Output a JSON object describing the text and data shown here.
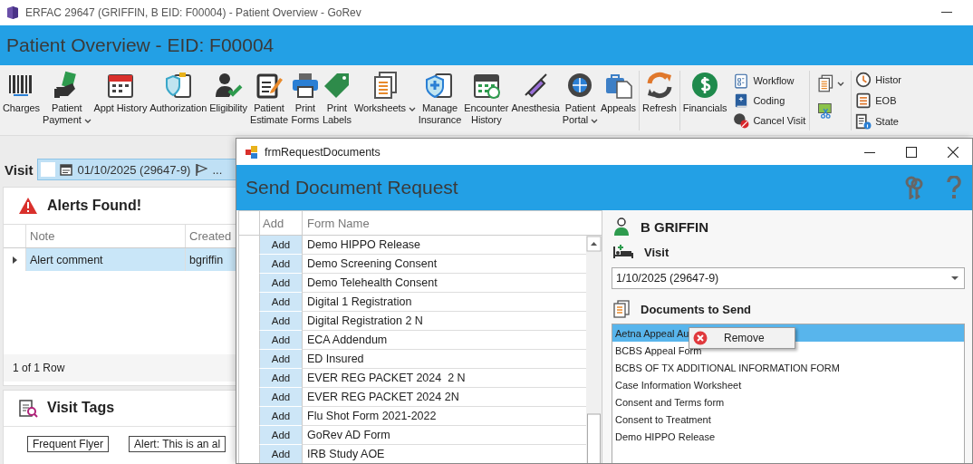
{
  "window": {
    "title": "ERFAC 29647 (GRIFFIN, B EID: F00004) - Patient Overview - GoRev"
  },
  "header": {
    "title": "Patient Overview - EID: F00004"
  },
  "toolbar": {
    "groups": [
      {
        "items": [
          {
            "kind": "large",
            "label": "Charges",
            "dropdown": false
          },
          {
            "kind": "large",
            "label": "Patient\nPayment",
            "dropdown": true
          },
          {
            "kind": "large",
            "label": "Appt History",
            "dropdown": false
          },
          {
            "kind": "large",
            "label": "Authorization",
            "dropdown": false
          },
          {
            "kind": "large",
            "label": "Eligibility",
            "dropdown": false
          },
          {
            "kind": "large",
            "label": "Patient\nEstimate",
            "dropdown": false
          },
          {
            "kind": "large",
            "label": "Print\nForms",
            "dropdown": false
          },
          {
            "kind": "large",
            "label": "Print\nLabels",
            "dropdown": false
          },
          {
            "kind": "large",
            "label": "Worksheets",
            "dropdown": true
          },
          {
            "kind": "large",
            "label": "Manage\nInsurance",
            "dropdown": false
          },
          {
            "kind": "large",
            "label": "Encounter\nHistory",
            "dropdown": false
          },
          {
            "kind": "large",
            "label": "Anesthesia",
            "dropdown": false
          },
          {
            "kind": "large",
            "label": "Patient\nPortal",
            "dropdown": true
          },
          {
            "kind": "large",
            "label": "Appeals",
            "dropdown": false
          }
        ]
      },
      {
        "items": [
          {
            "kind": "large",
            "label": "Refresh",
            "dropdown": false
          }
        ]
      },
      {
        "items": [
          {
            "kind": "large",
            "label": "Financials",
            "dropdown": false
          },
          {
            "kind": "small",
            "label": "Workflow",
            "dropdown": false
          },
          {
            "kind": "small",
            "label": "Coding",
            "dropdown": false
          },
          {
            "kind": "small",
            "label": "Cancel Visit",
            "dropdown": false
          }
        ]
      },
      {
        "items": [
          {
            "kind": "icon",
            "dropdown": true
          },
          {
            "kind": "icon",
            "dropdown": false
          }
        ]
      },
      {
        "items": [
          {
            "kind": "small",
            "label": "Histor",
            "dropdown": false
          },
          {
            "kind": "small",
            "label": "EOB",
            "dropdown": false
          },
          {
            "kind": "small",
            "label": "State",
            "dropdown": false
          }
        ]
      }
    ]
  },
  "visit_bar": {
    "label": "Visit",
    "checked": false,
    "value": "01/10/2025 (29647-9)",
    "more": "..."
  },
  "alerts": {
    "title": "Alerts Found!",
    "columns": [
      "Note",
      "Created"
    ],
    "rows": [
      {
        "cells": [
          "Alert comment",
          "bgriffin"
        ],
        "selected": true
      }
    ],
    "footer": "1 of 1 Row"
  },
  "visit_tags": {
    "title": "Visit Tags",
    "tags": [
      "Frequent Flyer",
      "Alert: This is an al"
    ]
  },
  "dialog": {
    "title": "frmRequestDocuments",
    "heading": "Send Document Request",
    "grid": {
      "columns": [
        "Add",
        "Form Name"
      ],
      "rows": [
        {
          "button": "Add",
          "name": "Demo HIPPO Release"
        },
        {
          "button": "Add",
          "name": "Demo Screening Consent"
        },
        {
          "button": "Add",
          "name": "Demo Telehealth Consent"
        },
        {
          "button": "Add",
          "name": "Digital 1 Registration"
        },
        {
          "button": "Add",
          "name": "Digital Registration 2 N"
        },
        {
          "button": "Add",
          "name": "ECA Addendum"
        },
        {
          "button": "Add",
          "name": "ED Insured"
        },
        {
          "button": "Add",
          "name": "EVER REG PACKET 2024  2 N"
        },
        {
          "button": "Add",
          "name": "EVER REG PACKET 2024 2N"
        },
        {
          "button": "Add",
          "name": "Flu Shot Form 2021-2022"
        },
        {
          "button": "Add",
          "name": "GoRev AD Form"
        },
        {
          "button": "Add",
          "name": "IRB Study AOE"
        }
      ]
    },
    "patient": "B GRIFFIN",
    "visit_label": "Visit",
    "visit_value": "1/10/2025 (29647-9)",
    "documents_label": "Documents to Send",
    "documents": [
      {
        "name": "Aetna Appeal Au",
        "selected": true
      },
      {
        "name": "BCBS Appeal Form",
        "selected": false
      },
      {
        "name": "BCBS OF TX ADDITIONAL INFORMATION FORM",
        "selected": false
      },
      {
        "name": "Case Information Worksheet",
        "selected": false
      },
      {
        "name": "Consent and Terms form",
        "selected": false
      },
      {
        "name": "Consent to Treatment",
        "selected": false
      },
      {
        "name": "Demo HIPPO Release",
        "selected": false
      }
    ],
    "context_menu": {
      "items": [
        "Remove"
      ]
    }
  }
}
